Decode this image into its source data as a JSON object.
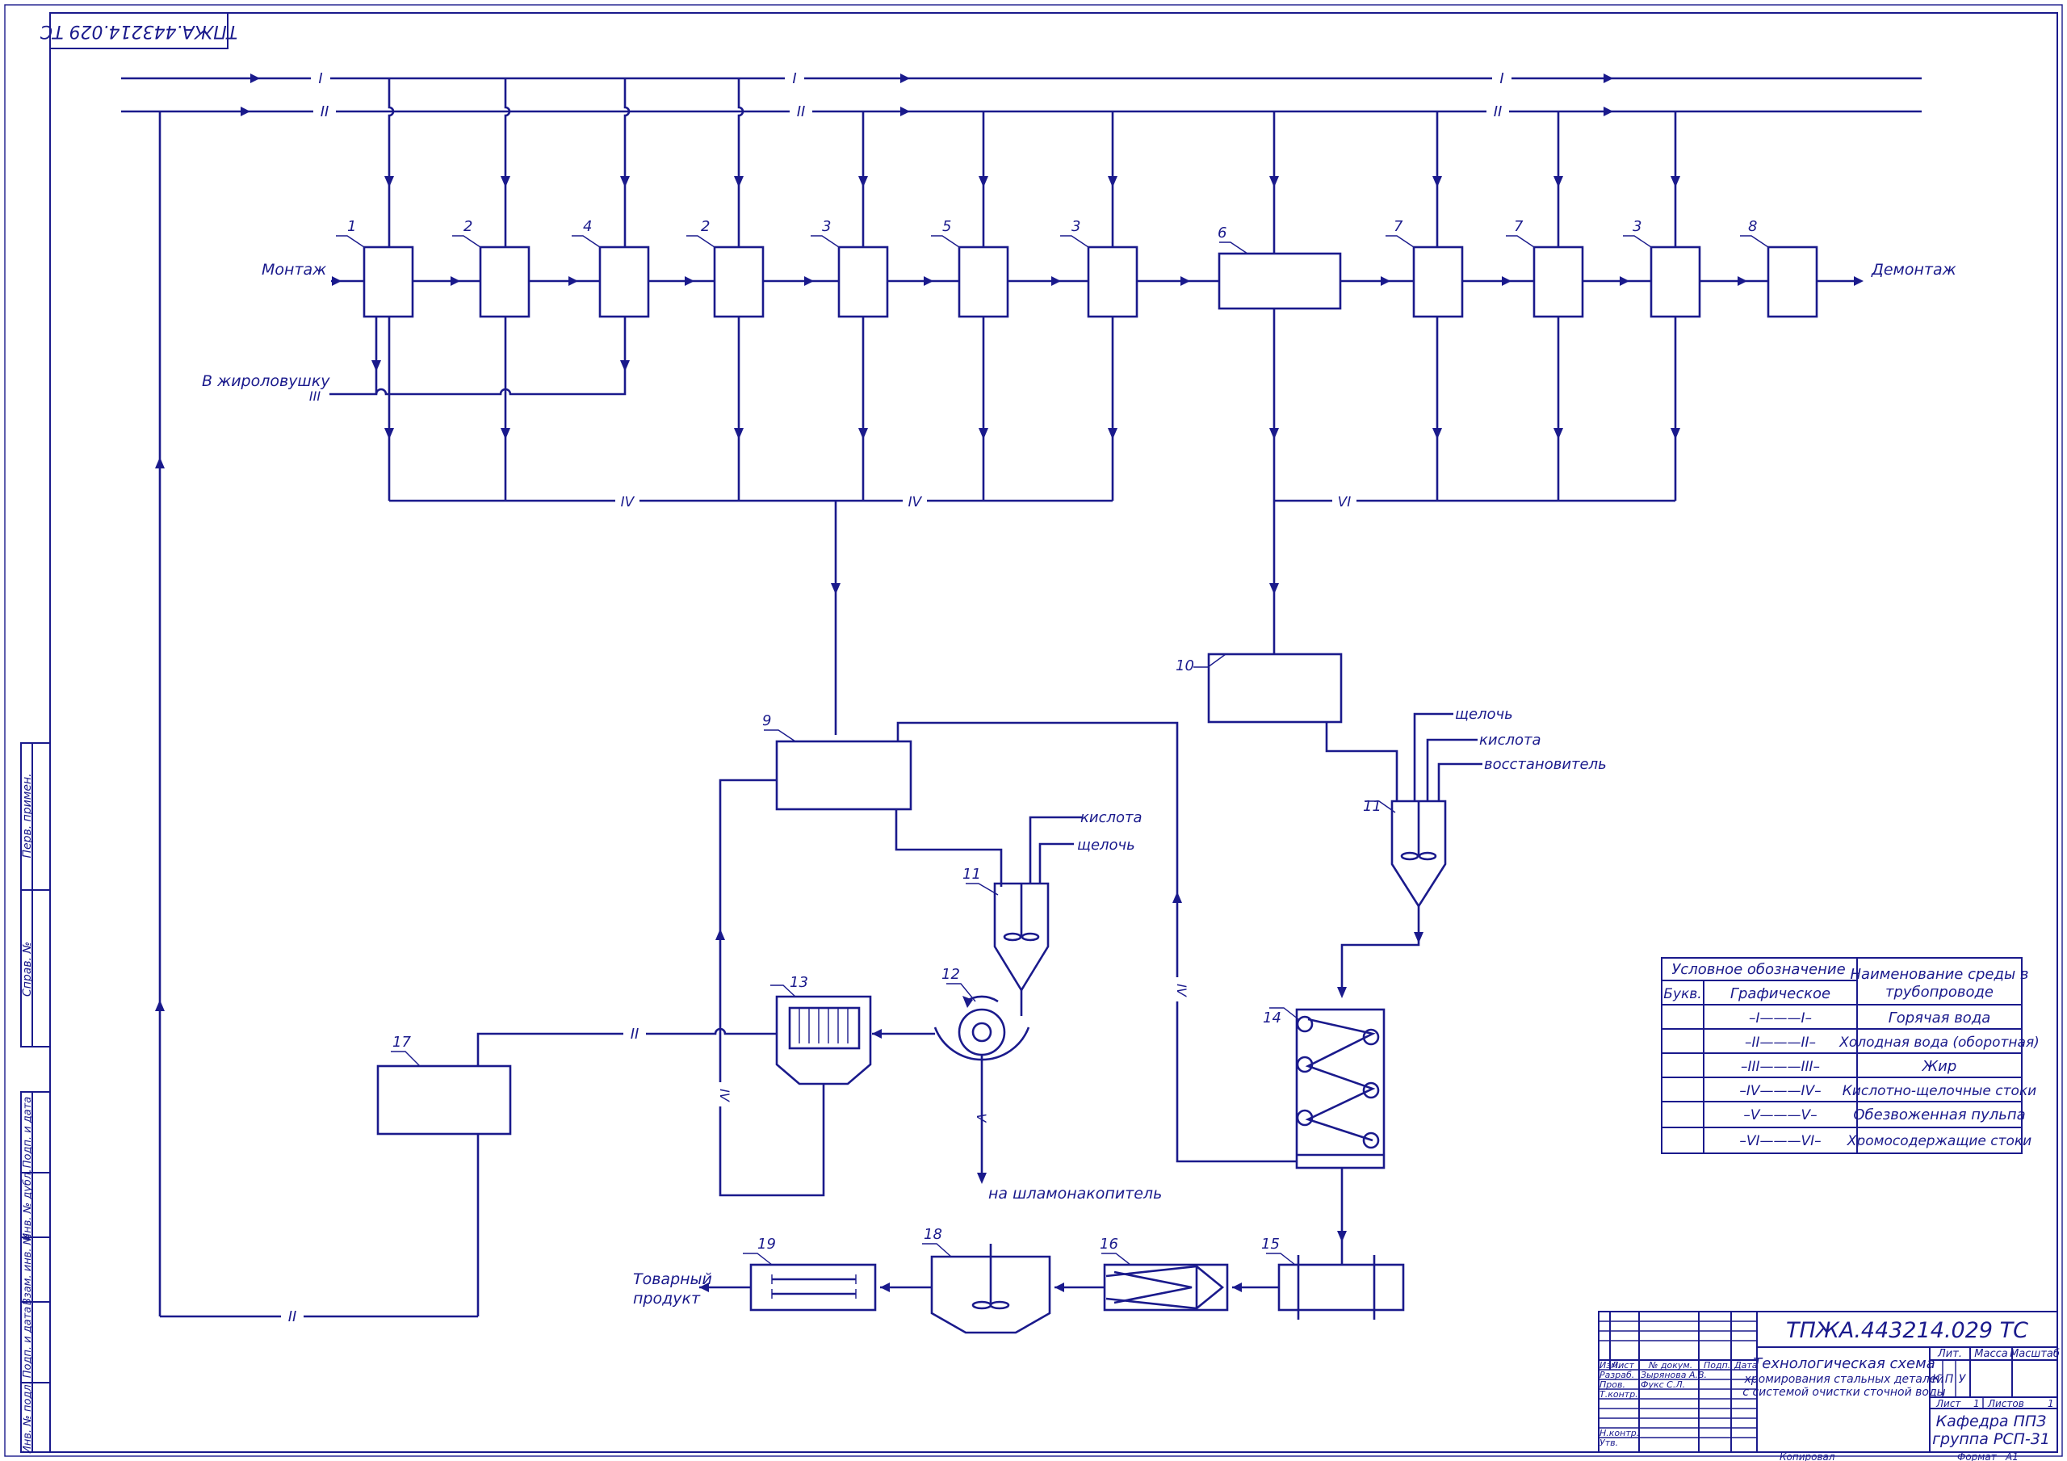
{
  "drawing": {
    "code": "ТПЖА.443214.029 ТС",
    "code_rotated": "ТПЖА.443214.029 ТС"
  },
  "line_labels": {
    "I": "I",
    "II": "II",
    "III": "III",
    "IV": "IV",
    "V": "V",
    "VI": "VI"
  },
  "flow_labels": {
    "mount": "Монтаж",
    "dismount": "Демонтаж",
    "to_grease_trap": "В жироловушку",
    "alkali": "щелочь",
    "acid": "кислота",
    "reducer": "восстановитель",
    "to_sludge": "на шламонакопитель",
    "product": "Товарный\nпродукт"
  },
  "equipment_numbers": {
    "n1": "1",
    "n2": "2",
    "n3": "3",
    "n4": "4",
    "n5": "5",
    "n6": "6",
    "n7": "7",
    "n8": "8",
    "n9": "9",
    "n10": "10",
    "n11": "11",
    "n12": "12",
    "n13": "13",
    "n14": "14",
    "n15": "15",
    "n16": "16",
    "n17": "17",
    "n18": "18",
    "n19": "19"
  },
  "legend": {
    "col_conventional": "Условное обозначение",
    "col_letter": "Букв.",
    "col_graphic": "Графическое",
    "col_medium": "Наименование среды в трубопроводе",
    "rows": [
      {
        "graphic": "–I———I–",
        "name": "Горячая вода"
      },
      {
        "graphic": "–II———II–",
        "name": "Холодная вода (оборотная)"
      },
      {
        "graphic": "–III———III–",
        "name": "Жир"
      },
      {
        "graphic": "–IV———IV–",
        "name": "Кислотно-щелочные стоки"
      },
      {
        "graphic": "–V———V–",
        "name": "Обезвоженная пульпа"
      },
      {
        "graphic": "–VI———VI–",
        "name": "Хромосодержащие стоки"
      }
    ]
  },
  "title_block": {
    "code": "ТПЖА.443214.029 ТС",
    "title_lines": [
      "Технологическая схема",
      "хромирования стальных деталей",
      "с системой очистки сточной воды"
    ],
    "hdr_izm": "Изм.",
    "hdr_list": "Лист",
    "hdr_doc": "№ докум.",
    "hdr_sign": "Подп.",
    "hdr_date": "Дата",
    "razrab": "Разраб.",
    "razrab_name": "Зырянова А.В.",
    "prov": "Пров.",
    "prov_name": "Фукс С.Л.",
    "tkontr": "Т.контр.",
    "nkontr": "Н.контр.",
    "utv": "Утв.",
    "lit": "Лит.",
    "massa": "Масса",
    "masshtab": "Масштаб",
    "lit_k": "К",
    "lit_p": "П",
    "lit_u": "У",
    "sheet": "Лист",
    "sheet_no": "1",
    "sheets": "Листов",
    "sheets_no": "1",
    "org_line1": "Кафедра ППЗ",
    "org_line2": "группа РСП-31",
    "kopiroval": "Копировал",
    "format": "Формат",
    "format_val": "А1"
  },
  "side_stamp": {
    "perv": "Перв. примен.",
    "sprav": "Справ. №",
    "podp_data_1": "Подп. и дата",
    "inv_dubl": "Инв. № дубл.",
    "vzam_inv": "Взам. инв. №",
    "podp_data_2": "Подп. и дата",
    "inv_podl": "Инв. № подл."
  }
}
